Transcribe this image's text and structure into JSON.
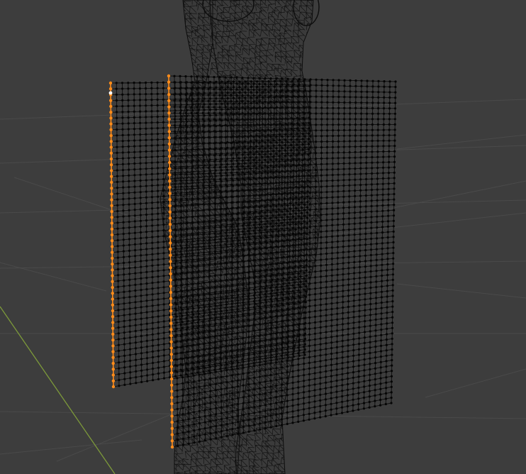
{
  "viewport": {
    "mode": "edit-mode",
    "shading": "wireframe"
  },
  "colors": {
    "background": "#3d3d3d",
    "floor_grid": "#4a4a4a",
    "floor_axis": "#7d9a3a",
    "wire_mesh": "#0d0d0d",
    "vertex": "#050505",
    "selected_vertex": "#ff8c1a",
    "active_vertex": "#ffffff"
  },
  "objects": [
    {
      "name": "body-wireframe-mesh",
      "selected": false
    },
    {
      "name": "cloth-plane-back",
      "selected": false,
      "selected_column": "left"
    },
    {
      "name": "cloth-plane-front",
      "selected": false,
      "selected_column": "left"
    }
  ]
}
